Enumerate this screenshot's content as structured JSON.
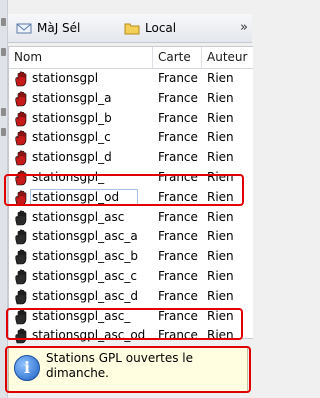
{
  "toolbar": {
    "maj_label": "MàJ Sél",
    "local_label": "Local",
    "more_icon": "double-chevron-right-icon"
  },
  "columns": {
    "name": "Nom",
    "carte": "Carte",
    "auteur": "Auteur"
  },
  "rows": [
    {
      "name": "stationsgpl",
      "carte": "France",
      "auteur": "Rien",
      "icon": "red-hand-icon"
    },
    {
      "name": "stationsgpl_a",
      "carte": "France",
      "auteur": "Rien",
      "icon": "red-hand-icon"
    },
    {
      "name": "stationsgpl_b",
      "carte": "France",
      "auteur": "Rien",
      "icon": "red-hand-icon"
    },
    {
      "name": "stationsgpl_c",
      "carte": "France",
      "auteur": "Rien",
      "icon": "red-hand-icon"
    },
    {
      "name": "stationsgpl_d",
      "carte": "France",
      "auteur": "Rien",
      "icon": "red-hand-icon"
    },
    {
      "name": "stationsgpl_",
      "carte": "France",
      "auteur": "Rien",
      "icon": "red-hand-icon"
    },
    {
      "name": "stationsgpl_od",
      "carte": "France",
      "auteur": "Rien",
      "icon": "red-hand-icon",
      "selected": true
    },
    {
      "name": "stationsgpl_asc",
      "carte": "France",
      "auteur": "Rien",
      "icon": "black-hand-icon"
    },
    {
      "name": "stationsgpl_asc_a",
      "carte": "France",
      "auteur": "Rien",
      "icon": "black-hand-icon"
    },
    {
      "name": "stationsgpl_asc_b",
      "carte": "France",
      "auteur": "Rien",
      "icon": "black-hand-icon"
    },
    {
      "name": "stationsgpl_asc_c",
      "carte": "France",
      "auteur": "Rien",
      "icon": "black-hand-icon"
    },
    {
      "name": "stationsgpl_asc_d",
      "carte": "France",
      "auteur": "Rien",
      "icon": "black-hand-icon"
    },
    {
      "name": "stationsgpl_asc_",
      "carte": "France",
      "auteur": "Rien",
      "icon": "black-hand-icon"
    },
    {
      "name": "stationsgpl_asc_od",
      "carte": "France",
      "auteur": "Rien",
      "icon": "black-hand-icon"
    }
  ],
  "info": {
    "text": "Stations GPL ouvertes le dimanche.",
    "icon": "info-icon"
  },
  "colors": {
    "highlight": "#e10000",
    "red_hand": "#c41a1a",
    "black_hand": "#2a2a2a",
    "info_bg": "#fffee0"
  }
}
